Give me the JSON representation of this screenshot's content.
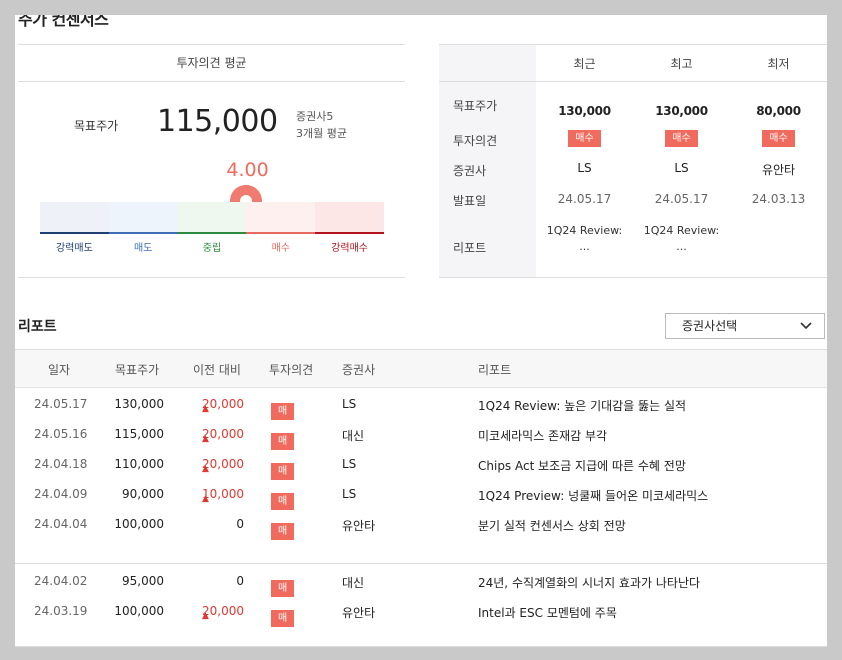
{
  "section_title": "주가 컨센서스",
  "opinion": {
    "header": "투자의견 평균",
    "target_label": "목표주가",
    "target_value": "115,000",
    "note_line1": "증권사5",
    "note_line2": "3개월 평균",
    "score": "4.00",
    "score_fraction": 0.6,
    "scale": [
      {
        "label": "강력매도",
        "label_color": "#1f3e72",
        "fill": "#eef2f8",
        "bar": "#1f3e72"
      },
      {
        "label": "매도",
        "label_color": "#3f6db5",
        "fill": "#eef4fc",
        "bar": "#3f6db5"
      },
      {
        "label": "중립",
        "label_color": "#2e8b3d",
        "fill": "#eef8ef",
        "bar": "#2e8b3d"
      },
      {
        "label": "매수",
        "label_color": "#e86a5f",
        "fill": "#fdf0ef",
        "bar": "#e86a5f"
      },
      {
        "label": "강력매수",
        "label_color": "#b4121c",
        "fill": "#fde6e6",
        "bar": "#b4121c"
      }
    ],
    "pin_color": "#f07b70"
  },
  "consensus": {
    "columns": [
      "최근",
      "최고",
      "최저"
    ],
    "row_labels": [
      "목표주가",
      "투자의견",
      "증권사",
      "발표일",
      "리포트"
    ],
    "target": [
      "130,000",
      "130,000",
      "80,000"
    ],
    "opinion": [
      "매수",
      "매수",
      "매수"
    ],
    "broker": [
      "LS",
      "LS",
      "유안타"
    ],
    "date": [
      "24.05.17",
      "24.05.17",
      "24.03.13"
    ],
    "report_line1": [
      "1Q24 Review:",
      "1Q24 Review:",
      ""
    ],
    "report_line2": [
      "...",
      "...",
      ""
    ]
  },
  "reports": {
    "title": "리포트",
    "select_label": "증권사선택",
    "headers": [
      "일자",
      "목표주가",
      "이전 대비",
      "투자의견",
      "증권사",
      "리포트"
    ],
    "rows": [
      {
        "date": "24.05.17",
        "target": "130,000",
        "diff": "20,000",
        "up": true,
        "opinion": "매수",
        "broker": "LS",
        "report": "1Q24 Review: 높은 기대감을 뚫는 실적"
      },
      {
        "date": "24.05.16",
        "target": "115,000",
        "diff": "20,000",
        "up": true,
        "opinion": "매수",
        "broker": "대신",
        "report": "미코세라믹스 존재감 부각"
      },
      {
        "date": "24.04.18",
        "target": "110,000",
        "diff": "20,000",
        "up": true,
        "opinion": "매수",
        "broker": "LS",
        "report": "Chips Act 보조금 지급에 따른 수혜 전망"
      },
      {
        "date": "24.04.09",
        "target": "90,000",
        "diff": "10,000",
        "up": true,
        "opinion": "매수",
        "broker": "LS",
        "report": "1Q24 Preview: 넝쿨째 들어온 미코세라믹스"
      },
      {
        "date": "24.04.04",
        "target": "100,000",
        "diff": "0",
        "up": false,
        "opinion": "매수",
        "broker": "유안타",
        "report": "분기 실적 컨센서스 상회 전망"
      },
      {
        "date": "24.04.02",
        "target": "95,000",
        "diff": "0",
        "up": false,
        "opinion": "매수",
        "broker": "대신",
        "report": "24년, 수직계열화의 시너지 효과가 나타난다"
      },
      {
        "date": "24.03.19",
        "target": "100,000",
        "diff": "20,000",
        "up": true,
        "opinion": "매수",
        "broker": "유안타",
        "report": "Intel과 ESC 모멘텀에 주목"
      }
    ]
  }
}
